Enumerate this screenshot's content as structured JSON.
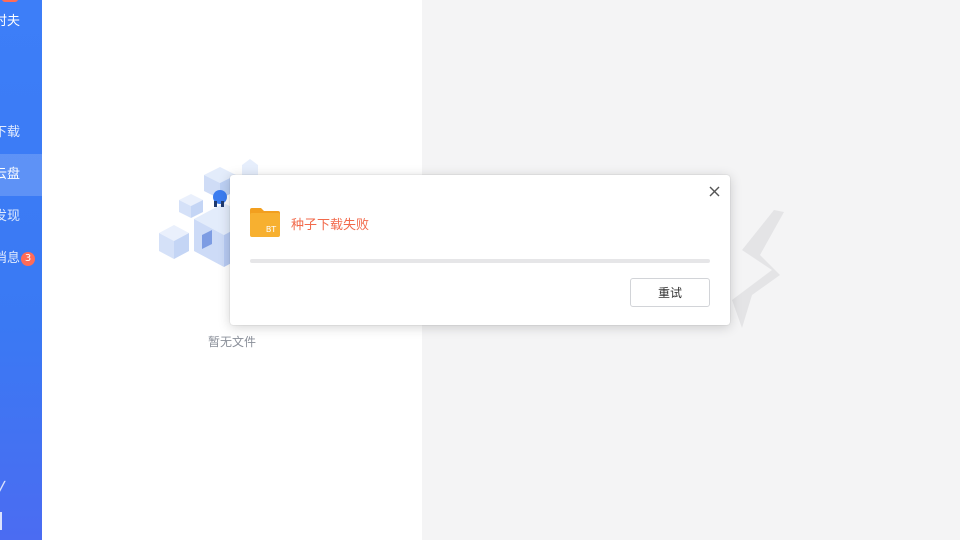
{
  "sidebar": {
    "user_name": "时夫",
    "items": [
      {
        "label": "下载",
        "active": false
      },
      {
        "label": "云盘",
        "active": true
      },
      {
        "label": "发现",
        "active": false
      },
      {
        "label": "消息",
        "active": false,
        "badge": "3"
      }
    ]
  },
  "file_list": {
    "empty_text": "暂无文件"
  },
  "dialog": {
    "message": "种子下载失败",
    "file_icon_label": "BT",
    "progress": 0,
    "retry_label": "重试"
  },
  "colors": {
    "sidebar": "#3d7ef8",
    "error_text": "#f26a4b",
    "badge": "#ff6b57",
    "folder": "#f7b030"
  }
}
